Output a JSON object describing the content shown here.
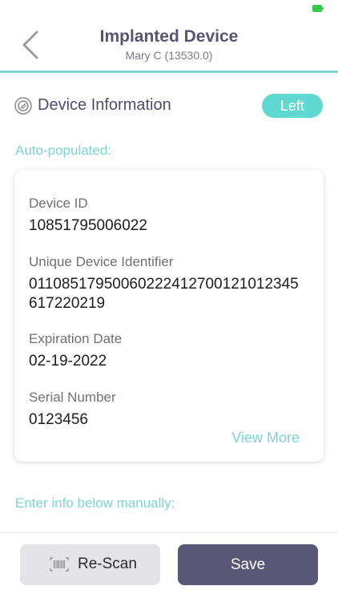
{
  "header": {
    "title": "Implanted Device",
    "subtitle": "Mary C (13530.0)"
  },
  "section": {
    "title": "Device Information",
    "side_badge": "Left"
  },
  "auto_populated_label": "Auto-populated:",
  "device": {
    "device_id_label": "Device ID",
    "device_id_value": "10851795006022",
    "udi_label": "Unique Device Identifier",
    "udi_value_line1": "01108517950060222412700121012345",
    "udi_value_line2": "617220219",
    "expiration_label": "Expiration Date",
    "expiration_value": "02-19-2022",
    "serial_label": "Serial Number",
    "serial_value": "0123456",
    "view_more": "View More"
  },
  "manual_label": "Enter info below manually:",
  "footer": {
    "rescan_label": "Re-Scan",
    "save_label": "Save"
  },
  "colors": {
    "accent": "#79d6d2",
    "pill": "#5ed8d1",
    "primary_button": "#585876",
    "secondary_button": "#e3e3e8",
    "title": "#555574"
  },
  "icons": {
    "back": "chevron-left-icon",
    "device": "implant-device-icon",
    "rescan": "barcode-icon",
    "battery": "battery-icon"
  }
}
